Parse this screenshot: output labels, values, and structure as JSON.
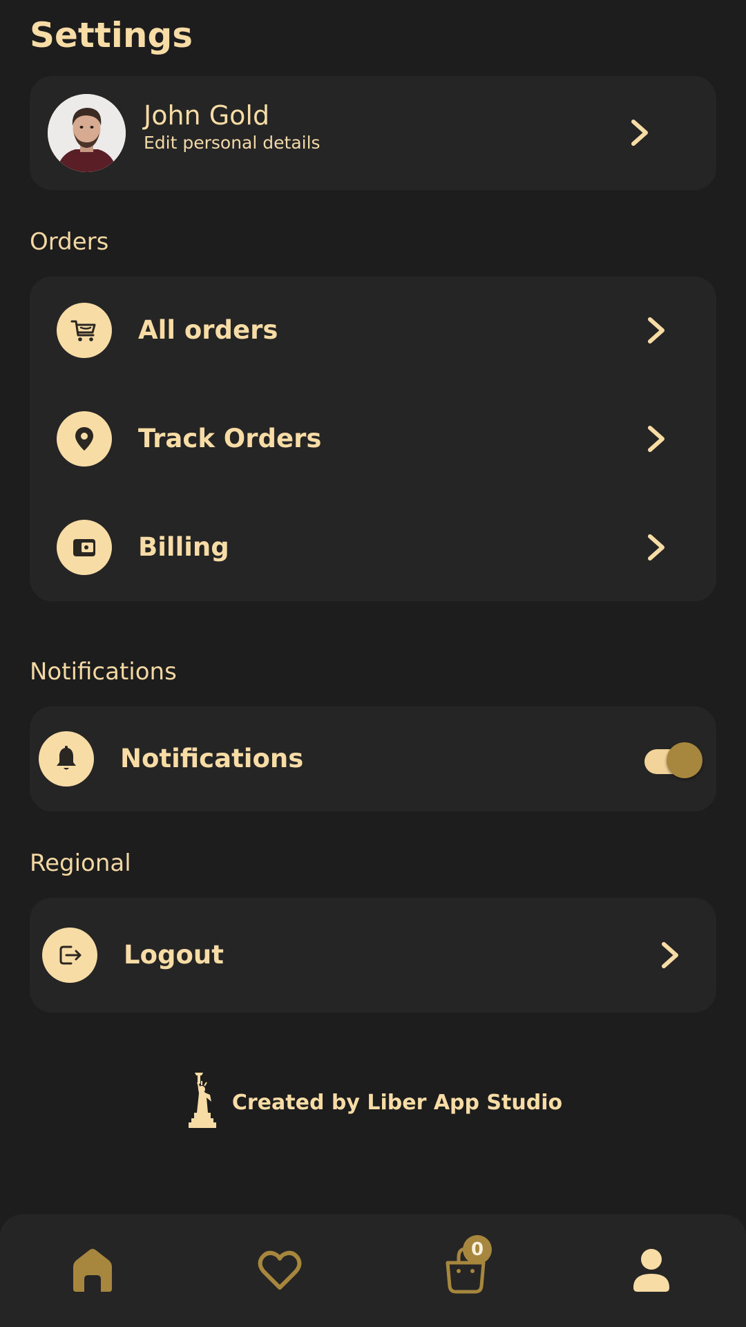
{
  "page": {
    "title": "Settings"
  },
  "profile": {
    "name": "John Gold",
    "subtitle": "Edit personal details"
  },
  "sections": {
    "orders": {
      "label": "Orders",
      "items": [
        {
          "label": "All orders",
          "icon": "cart-icon"
        },
        {
          "label": "Track Orders",
          "icon": "location-pin-icon"
        },
        {
          "label": "Billing",
          "icon": "wallet-icon"
        }
      ]
    },
    "notifications": {
      "label": "Notifications",
      "item": {
        "label": "Notifications",
        "icon": "bell-icon",
        "enabled": true
      }
    },
    "regional": {
      "label": "Regional",
      "items": [
        {
          "label": "Logout",
          "icon": "logout-icon"
        }
      ]
    }
  },
  "footer": {
    "credit": "Created by Liber App Studio",
    "logo": "statue-of-liberty-icon"
  },
  "bottom_nav": {
    "items": [
      "home-icon",
      "heart-icon",
      "bag-icon",
      "profile-icon"
    ],
    "active": "home-icon",
    "cart_count": "0"
  },
  "colors": {
    "background": "#1e1d1d",
    "card": "#262525",
    "accent": "#f8dca6",
    "gold": "#a7863e"
  }
}
